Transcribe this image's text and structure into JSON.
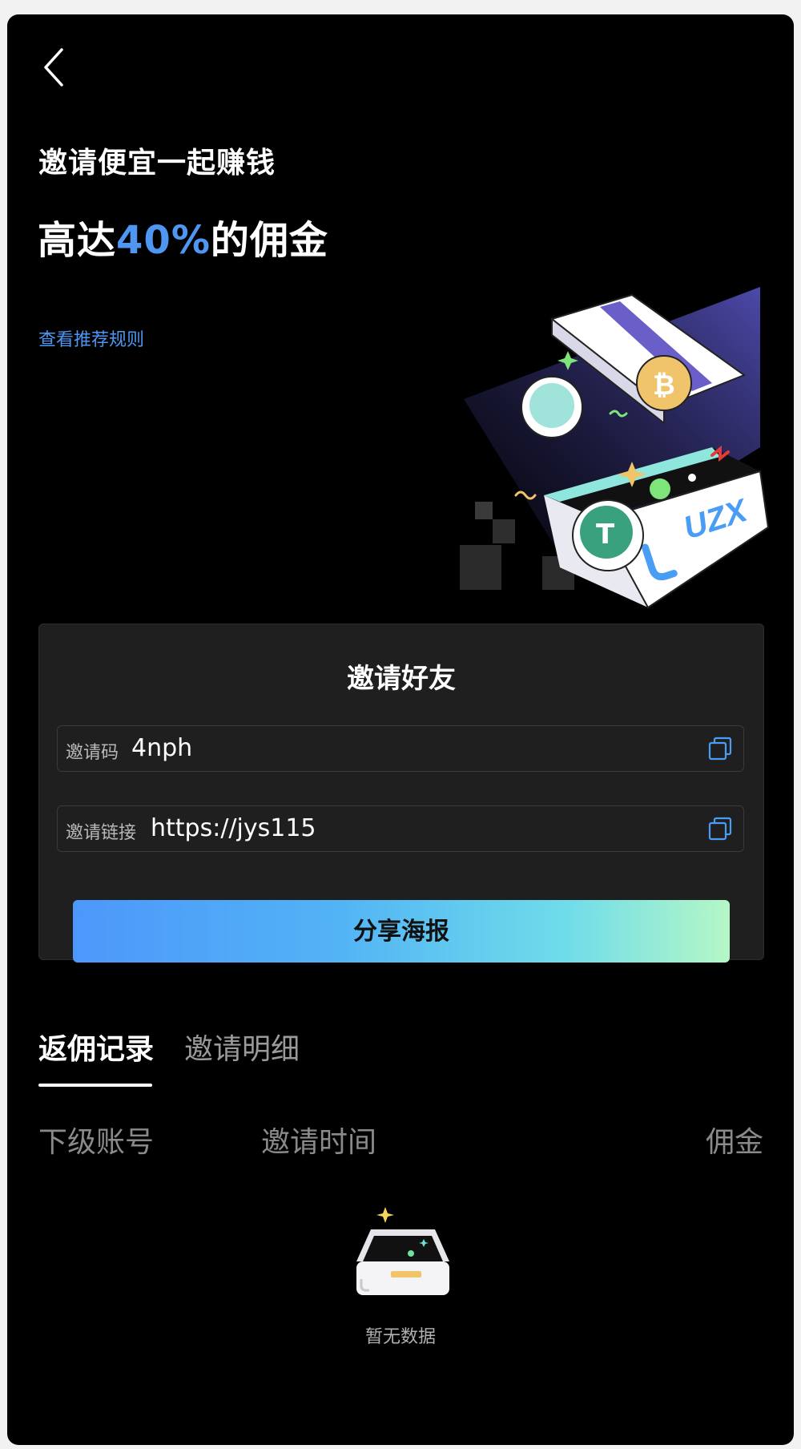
{
  "header": {
    "back_icon": "chevron-left-icon"
  },
  "hero": {
    "subtitle": "邀请便宜一起赚钱",
    "headline_prefix": "高达",
    "headline_accent": "40%",
    "headline_suffix": "的佣金",
    "rules_link": "查看推荐规则",
    "brand_text": "UZX",
    "accent_color": "#4e96f2"
  },
  "invite_card": {
    "title": "邀请好友",
    "code_label": "邀请码",
    "code_value": "4nph",
    "link_label": "邀请链接",
    "link_value": "https://jys115",
    "copy_icon": "copy-icon",
    "share_button": "分享海报"
  },
  "tabs": {
    "active": "返佣记录",
    "inactive": "邀请明细"
  },
  "table": {
    "columns": [
      "下级账号",
      "邀请时间",
      "佣金"
    ],
    "empty_text": "暂无数据"
  }
}
